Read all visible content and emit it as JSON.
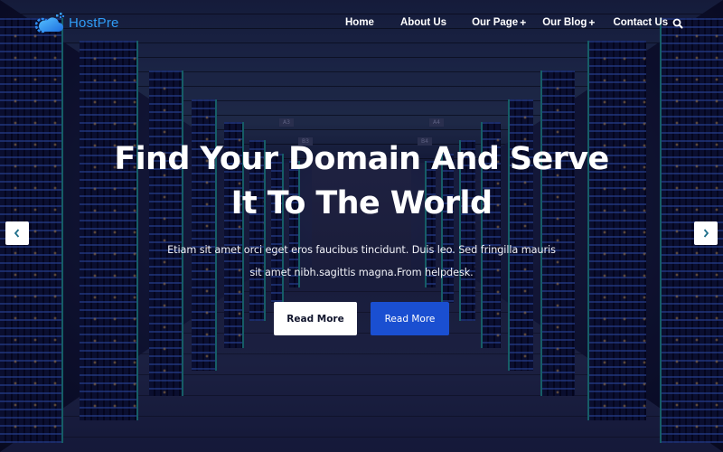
{
  "brand": {
    "name": "HostPre",
    "logo_icon": "cloud-gear-icon",
    "color": "#2f9cf5"
  },
  "nav": {
    "items": [
      {
        "label": "Home",
        "has_submenu": false
      },
      {
        "label": "About Us",
        "has_submenu": false
      },
      {
        "label": "Our Page",
        "has_submenu": true
      },
      {
        "label": "Our Blog",
        "has_submenu": true
      },
      {
        "label": "Contact Us",
        "has_submenu": false
      }
    ],
    "submenu_marker": "+",
    "search_icon": "search-icon"
  },
  "hero": {
    "title_line1": "Find Your Domain And Serve",
    "title_line2": "It To The World",
    "description_line1": "Etiam sit amet orci eget eros faucibus tincidunt. Duis leo. Sed fringilla mauris",
    "description_line2": "sit amet nibh.sagittis magna.From helpdesk.",
    "primary_button": "Read More",
    "secondary_button": "Read More",
    "background": "server-room-corridor",
    "signs": [
      "A3",
      "A4",
      "B3",
      "B4"
    ]
  },
  "slider": {
    "prev_icon": "chevron-left-icon",
    "next_icon": "chevron-right-icon",
    "prev_glyph": "‹",
    "next_glyph": "›"
  },
  "colors": {
    "accent": "#1a4fd1",
    "brand": "#2f9cf5",
    "arrow_glyph": "#1f6f8a"
  }
}
